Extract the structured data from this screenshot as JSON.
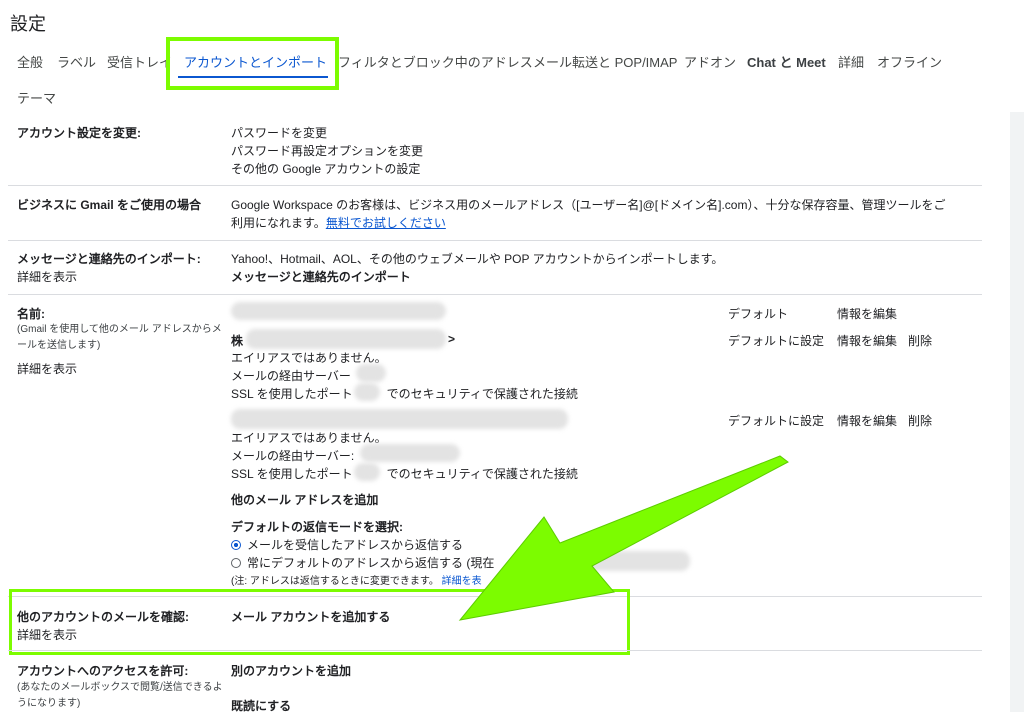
{
  "page_title": "設定",
  "tabs": [
    {
      "label": "全般"
    },
    {
      "label": "ラベル"
    },
    {
      "label": "受信トレイ"
    },
    {
      "label": "アカウントとインポート"
    },
    {
      "label": "フィルタとブロック中のアドレス"
    },
    {
      "label": "メール転送と POP/IMAP"
    },
    {
      "label": "アドオン"
    },
    {
      "label": "Chat と Meet"
    },
    {
      "label": "詳細"
    },
    {
      "label": "オフライン"
    },
    {
      "label": "テーマ"
    }
  ],
  "account_settings": {
    "label": "アカウント設定を変更:",
    "links": [
      "パスワードを変更",
      "パスワード再設定オプションを変更",
      "その他の Google アカウントの設定"
    ]
  },
  "business": {
    "label": "ビジネスに Gmail をご使用の場合",
    "text_line1": "Google Workspace のお客様は、ビジネス用のメールアドレス（[ユーザー名]@[ドメイン名].com）、十分な保存容量、管理ツールをご",
    "text_line2": "利用になれます。",
    "trial_link": "無料でお試しください"
  },
  "import": {
    "label": "メッセージと連絡先のインポート:",
    "details_link": "詳細を表示",
    "text": "Yahoo!、Hotmail、AOL、その他のウェブメールや POP アカウントからインポートします。",
    "action_link": "メッセージと連絡先のインポート"
  },
  "name": {
    "label": "名前:",
    "sub_label": "(Gmail を使用して他のメール アドレスからメールを送信します)",
    "details_link": "詳細を表示",
    "account1": {
      "status": "デフォルト",
      "edit": "情報を編集"
    },
    "account2": {
      "name_prefix": "株",
      "name_suffix": ">",
      "alias": "エイリアスではありません。",
      "server": "メールの経由サーバー",
      "ssl_prefix": "SSL を使用したポート",
      "ssl_suffix": "でのセキュリティで保護された接続",
      "set_default": "デフォルトに設定",
      "edit": "情報を編集",
      "delete": "削除"
    },
    "account3": {
      "alias": "エイリアスではありません。",
      "server": "メールの経由サーバー:",
      "ssl_prefix": "SSL を使用したポート",
      "ssl_suffix": "でのセキュリティで保護された接続",
      "set_default": "デフォルトに設定",
      "edit": "情報を編集",
      "delete": "削除"
    },
    "add_address": "他のメール アドレスを追加",
    "reply_mode_label": "デフォルトの返信モードを選択:",
    "reply_options": [
      "メールを受信したアドレスから返信する",
      "常にデフォルトのアドレスから返信する (現在"
    ],
    "note": "(注: アドレスは返信するときに変更できます。",
    "note_link": "詳細を表"
  },
  "check_mail": {
    "label": "他のアカウントのメールを確認:",
    "details_link": "詳細を表示",
    "action_link": "メール アカウントを追加する"
  },
  "grant_access": {
    "label": "アカウントへのアクセスを許可:",
    "sub_label": "(あなたのメールボックスで閲覧/送信できるようになります)",
    "action_link": "別のアカウントを追加",
    "mark_read": "既読にする"
  },
  "colors": {
    "highlight": "#7cfc00",
    "link": "#0b57d0"
  }
}
